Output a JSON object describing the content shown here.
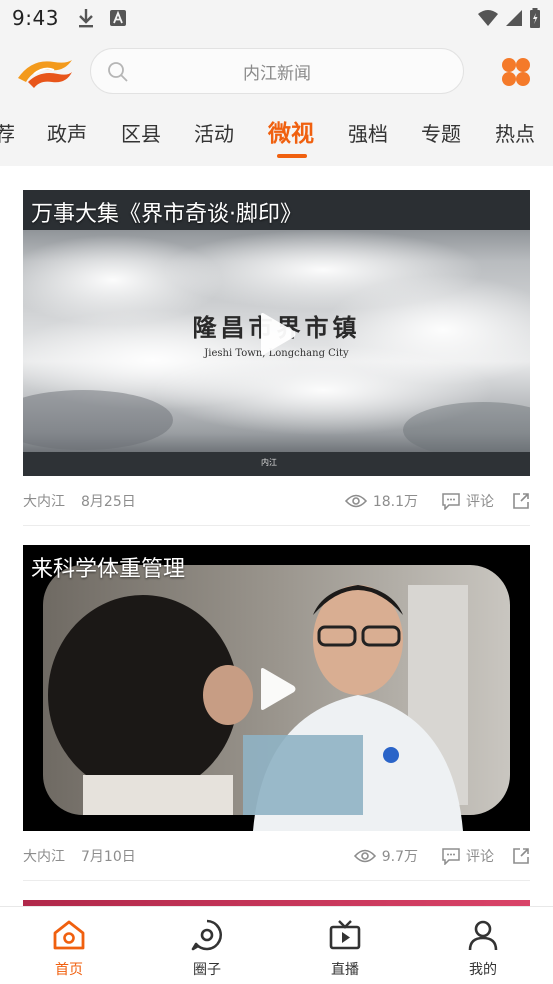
{
  "status_bar": {
    "time": "9:43"
  },
  "header": {
    "search_placeholder": "内江新闻"
  },
  "tabs": [
    {
      "label": "荐"
    },
    {
      "label": "政声"
    },
    {
      "label": "区县"
    },
    {
      "label": "活动"
    },
    {
      "label": "微视",
      "active": true
    },
    {
      "label": "强档"
    },
    {
      "label": "专题"
    },
    {
      "label": "热点"
    }
  ],
  "feed": {
    "items": [
      {
        "title": "万事大集《界市奇谈·脚印》",
        "overlay_title": "隆昌市界市镇",
        "overlay_subtitle": "Jieshi Town, Longchang City",
        "watermark": "内江",
        "source": "大内江",
        "date": "8月25日",
        "views": "18.1万",
        "comment_label": "评论"
      },
      {
        "title": "来科学体重管理",
        "source": "大内江",
        "date": "7月10日",
        "views": "9.7万",
        "comment_label": "评论"
      }
    ]
  },
  "bottom_nav": [
    {
      "label": "首页",
      "icon": "home-icon",
      "active": true
    },
    {
      "label": "圈子",
      "icon": "circle-icon"
    },
    {
      "label": "直播",
      "icon": "tv-icon"
    },
    {
      "label": "我的",
      "icon": "user-icon"
    }
  ],
  "colors": {
    "accent": "#f0600f",
    "header_bg": "#f4f4f4"
  }
}
